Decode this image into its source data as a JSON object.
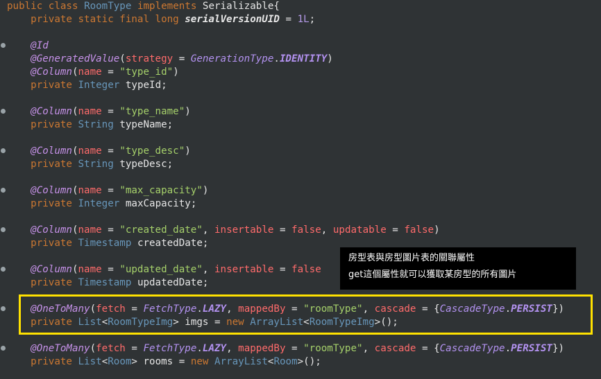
{
  "code": {
    "l1_kw1": "public",
    "l1_kw2": "class",
    "l1_cls": "RoomType",
    "l1_kw3": "implements",
    "l1_iface": "Serializable{",
    "l2_mods": "private static final long",
    "l2_field": "serialVersionUID",
    "l2_eq": " = ",
    "l2_val": "1L",
    "l2_end": ";",
    "id_ann": "@Id",
    "gv_ann": "@GeneratedValue",
    "gv_param": "strategy",
    "gv_type": "GenerationType",
    "gv_const": "IDENTITY",
    "column_ann": "@Column",
    "name_param": "name",
    "private_kw": "private",
    "integer_type": "Integer",
    "string_type": "String",
    "timestamp_type": "Timestamp",
    "col1_str": "\"type_id\"",
    "f1_name": "typeId;",
    "col2_str": "\"type_name\"",
    "f2_name": "typeName;",
    "col3_str": "\"type_desc\"",
    "f3_name": "typeDesc;",
    "col4_str": "\"max_capacity\"",
    "f4_name": "maxCapacity;",
    "col5_str": "\"created_date\"",
    "insertable_param": "insertable",
    "updatable_param": "updatable",
    "false_kw": "false",
    "f5_name": "createdDate;",
    "col6_str": "\"updated_date\"",
    "f6_name": "updatedDate;",
    "otm_ann": "@OneToMany",
    "fetch_param": "fetch",
    "fetch_type": "FetchType",
    "lazy_const": "LAZY",
    "mapped_param": "mappedBy",
    "mapped_str": "\"roomType\"",
    "cascade_param": "cascade",
    "cascade_type": "CascadeType",
    "persist_const": "PERSIST",
    "list_type": "List",
    "img_type": "RoomTypeImg",
    "f7_name": "imgs",
    "new_kw": "new",
    "arraylist_type": "ArrayList",
    "room_type": "Room",
    "f8_name": "rooms"
  },
  "tooltip": {
    "line1": "房型表與房型圖片表的關聯屬性",
    "line2": "get這個屬性就可以獲取某房型的所有圖片"
  },
  "colors": {
    "highlight_box": "#ffe100",
    "background": "#2f3335"
  }
}
